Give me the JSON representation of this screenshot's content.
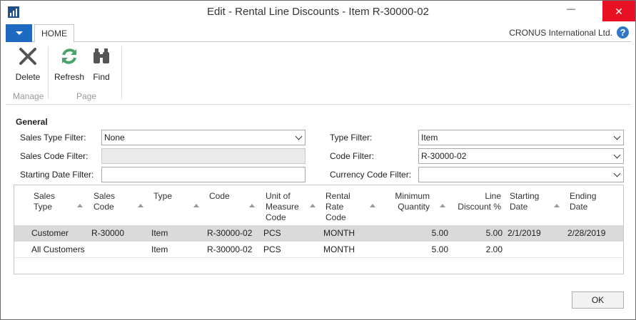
{
  "window": {
    "title": "Edit - Rental Line Discounts - Item R-30000-02",
    "minimize_glyph": "—",
    "maximize_glyph": "☐",
    "close_glyph": "✕"
  },
  "ribbon": {
    "tab_home": "HOME",
    "company": "CRONUS International Ltd.",
    "help_glyph": "?",
    "delete_label": "Delete",
    "refresh_label": "Refresh",
    "find_label": "Find",
    "group_manage": "Manage",
    "group_page": "Page",
    "accent": "#1e6ac2"
  },
  "general": {
    "title": "General",
    "sales_type_filter_label": "Sales Type Filter:",
    "sales_type_filter_value": "None",
    "sales_code_filter_label": "Sales Code Filter:",
    "sales_code_filter_value": "",
    "starting_date_filter_label": "Starting Date Filter:",
    "starting_date_filter_value": "",
    "type_filter_label": "Type Filter:",
    "type_filter_value": "Item",
    "code_filter_label": "Code Filter:",
    "code_filter_value": "R-30000-02",
    "currency_code_filter_label": "Currency Code Filter:",
    "currency_code_filter_value": ""
  },
  "grid": {
    "headers": {
      "sales_type": [
        "Sales",
        "Type"
      ],
      "sales_code": [
        "Sales",
        "Code"
      ],
      "type": [
        "Type"
      ],
      "code": [
        "Code"
      ],
      "uom": [
        "Unit of",
        "Measure",
        "Code"
      ],
      "rental_rate": [
        "Rental",
        "Rate",
        "Code"
      ],
      "min_qty": [
        "Minimum",
        "Quantity"
      ],
      "line_disc": [
        "Line",
        "Discount %"
      ],
      "starting_date": [
        "Starting",
        "Date"
      ],
      "ending_date": [
        "Ending",
        "Date"
      ]
    },
    "rows": [
      {
        "sales_type": "Customer",
        "sales_code": "R-30000",
        "type": "Item",
        "code": "R-30000-02",
        "uom": "PCS",
        "rental_rate": "MONTH",
        "min_qty": "5.00",
        "line_disc": "5.00",
        "starting_date": "2/1/2019",
        "ending_date": "2/28/2019"
      },
      {
        "sales_type": "All Customers",
        "sales_code": "",
        "type": "Item",
        "code": "R-30000-02",
        "uom": "PCS",
        "rental_rate": "MONTH",
        "min_qty": "5.00",
        "line_disc": "2.00",
        "starting_date": "",
        "ending_date": ""
      }
    ]
  },
  "footer": {
    "ok_label": "OK"
  }
}
